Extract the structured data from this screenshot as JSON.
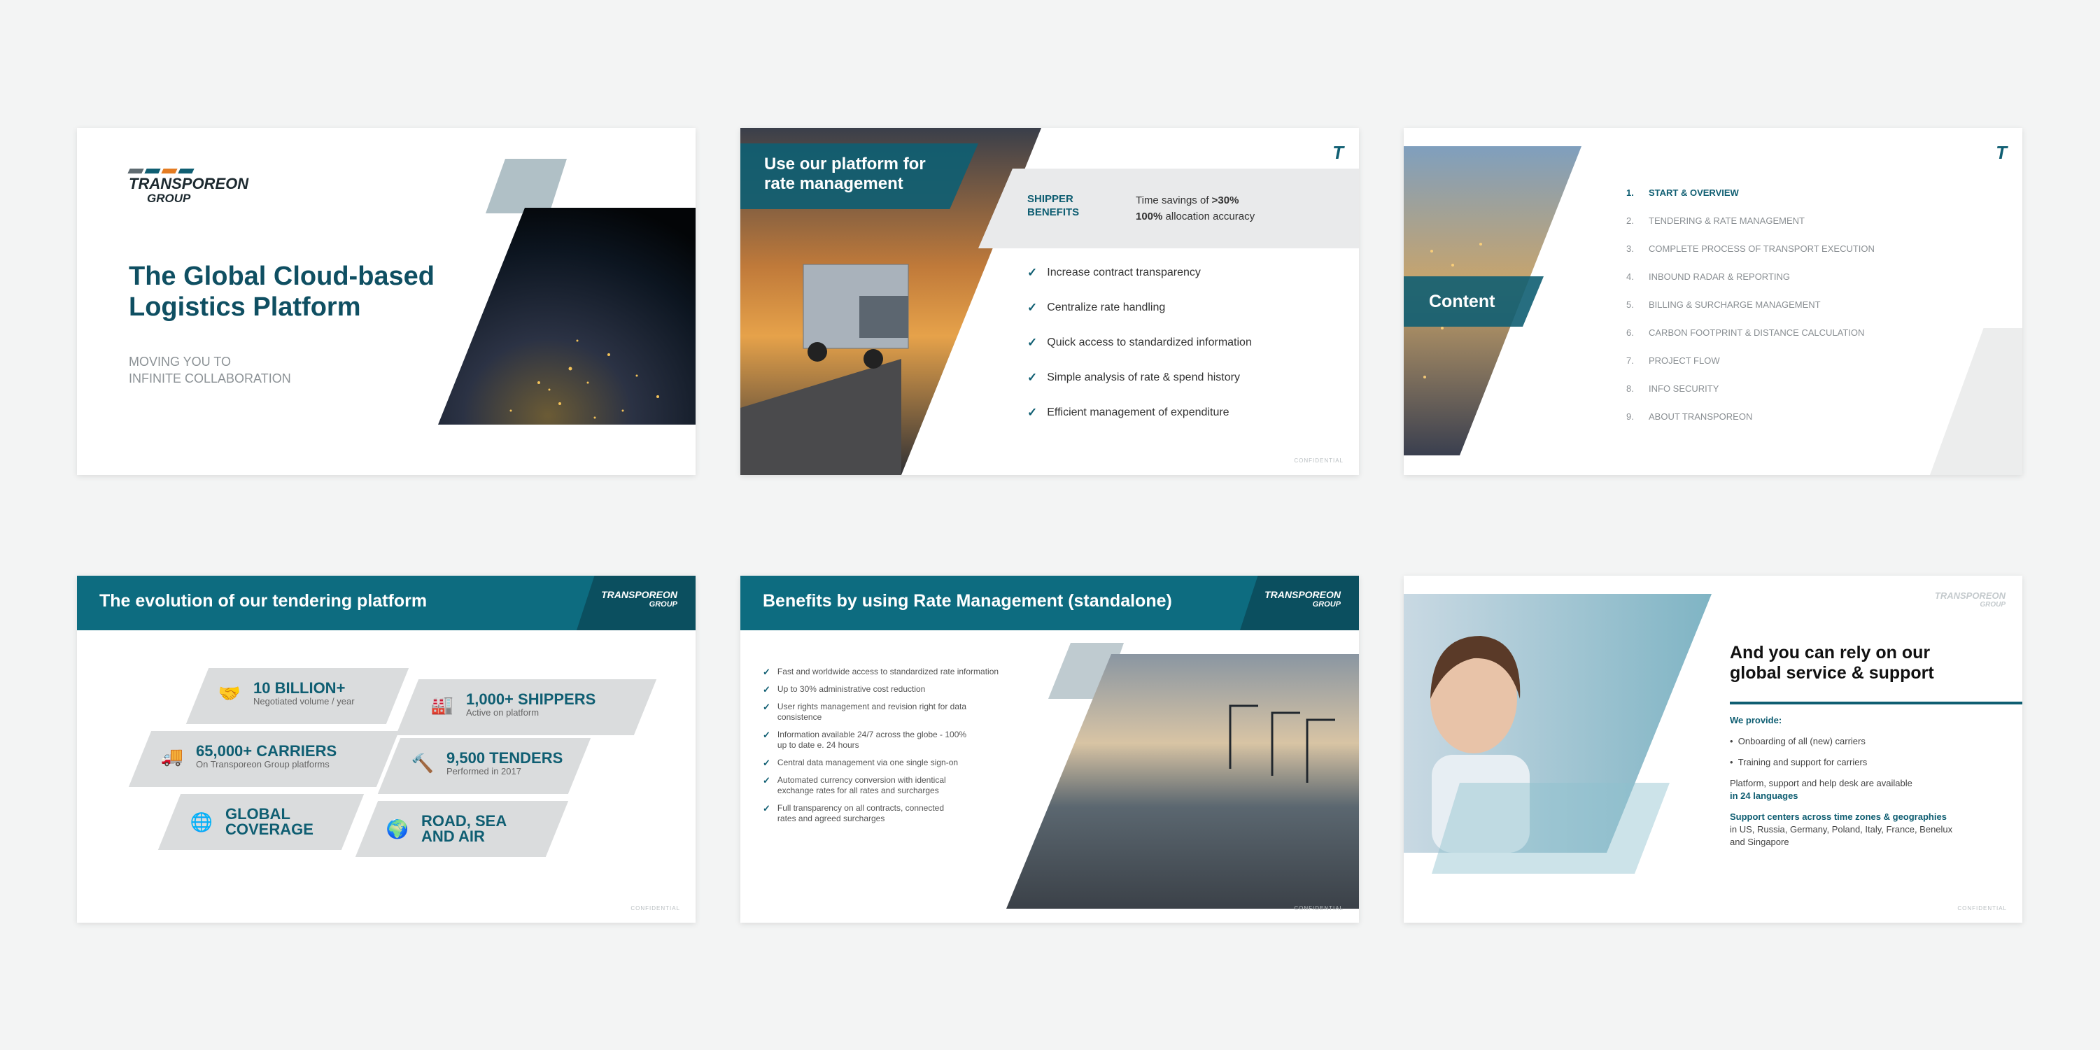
{
  "colors": {
    "teal": "#0f5e72",
    "banner": "#0d6c80",
    "gray": "#dadcdd",
    "background": "#f3f4f4"
  },
  "logo": {
    "name": "TRANSPOREON",
    "group": "GROUP",
    "stripe_colors": [
      "#5f6b71",
      "#0f5e72",
      "#e47c22",
      "#0f5e72"
    ]
  },
  "slide1": {
    "title_line1": "The Global Cloud-based",
    "title_line2": "Logistics Platform",
    "sub_line1": "MOVING YOU TO",
    "sub_line2": "INFINITE COLLABORATION"
  },
  "slide2": {
    "title_line1": "Use our platform for",
    "title_line2": "rate management",
    "box_label_line1": "SHIPPER",
    "box_label_line2": "BENEFITS",
    "box_text1_a": "Time savings of ",
    "box_text1_b": ">30%",
    "box_text2_a": "100%",
    "box_text2_b": " allocation accuracy",
    "items": [
      "Increase contract transparency",
      "Centralize rate handling",
      "Quick access to standardized information",
      "Simple analysis of rate & spend history",
      "Efficient management of expenditure"
    ],
    "footer": "CONFIDENTIAL"
  },
  "slide3": {
    "label": "Content",
    "items": [
      {
        "num": "1.",
        "text": "START & OVERVIEW"
      },
      {
        "num": "2.",
        "text": "TENDERING & RATE MANAGEMENT"
      },
      {
        "num": "3.",
        "text": "COMPLETE PROCESS OF TRANSPORT EXECUTION"
      },
      {
        "num": "4.",
        "text": "INBOUND RADAR & REPORTING"
      },
      {
        "num": "5.",
        "text": "BILLING & SURCHARGE MANAGEMENT"
      },
      {
        "num": "6.",
        "text": "CARBON FOOTPRINT & DISTANCE CALCULATION"
      },
      {
        "num": "7.",
        "text": "PROJECT FLOW"
      },
      {
        "num": "8.",
        "text": "INFO SECURITY"
      },
      {
        "num": "9.",
        "text": "ABOUT TRANSPOREON"
      }
    ]
  },
  "slide4": {
    "title": "The evolution of our tendering platform",
    "stats": [
      {
        "icon": "handshake-icon",
        "title": "10 BILLION+",
        "sub": "Negotiated volume / year"
      },
      {
        "icon": "factory-icon",
        "title": "1,000+ SHIPPERS",
        "sub": "Active on platform"
      },
      {
        "icon": "truck-icon",
        "title": "65,000+ CARRIERS",
        "sub": "On Transporeon Group platforms"
      },
      {
        "icon": "gavel-icon",
        "title": "9,500 TENDERS",
        "sub": "Performed in 2017"
      },
      {
        "icon": "globe-icon",
        "title_line1": "GLOBAL",
        "title_line2": "COVERAGE"
      },
      {
        "icon": "world-grid-icon",
        "title_line1": "ROAD, SEA",
        "title_line2": "AND AIR"
      }
    ],
    "footer": "CONFIDENTIAL"
  },
  "slide5": {
    "title": "Benefits by using Rate Management (standalone)",
    "items": [
      {
        "l1": "Fast and worldwide access to standardized rate information",
        "l2": ""
      },
      {
        "l1": "Up to 30% administrative cost reduction",
        "l2": ""
      },
      {
        "l1": "User rights management and revision right for data",
        "l2": "consistence"
      },
      {
        "l1": "Information available 24/7 across the globe - 100%",
        "l2": "up to date e. 24 hours"
      },
      {
        "l1": "Central data management via one single sign-on",
        "l2": ""
      },
      {
        "l1": "Automated currency conversion with identical",
        "l2": "exchange rates for all rates and surcharges"
      },
      {
        "l1": "Full transparency on all contracts, connected",
        "l2": "rates and agreed surcharges"
      }
    ],
    "footer": "CONFIDENTIAL"
  },
  "slide6": {
    "heading_line1": "And you can rely on our",
    "heading_line2": "global service & support",
    "we_provide": "We provide:",
    "bullets": [
      "Onboarding of all (new) carriers",
      "Training and support for carriers"
    ],
    "para1": "Platform, support and help desk are available",
    "para1_bold": "in 24 languages",
    "para2_bold": "Support centers across time zones & geographies",
    "para2_line1": "in US, Russia, Germany, Poland, Italy, France, Benelux",
    "para2_line2": "and Singapore",
    "footer": "CONFIDENTIAL"
  }
}
